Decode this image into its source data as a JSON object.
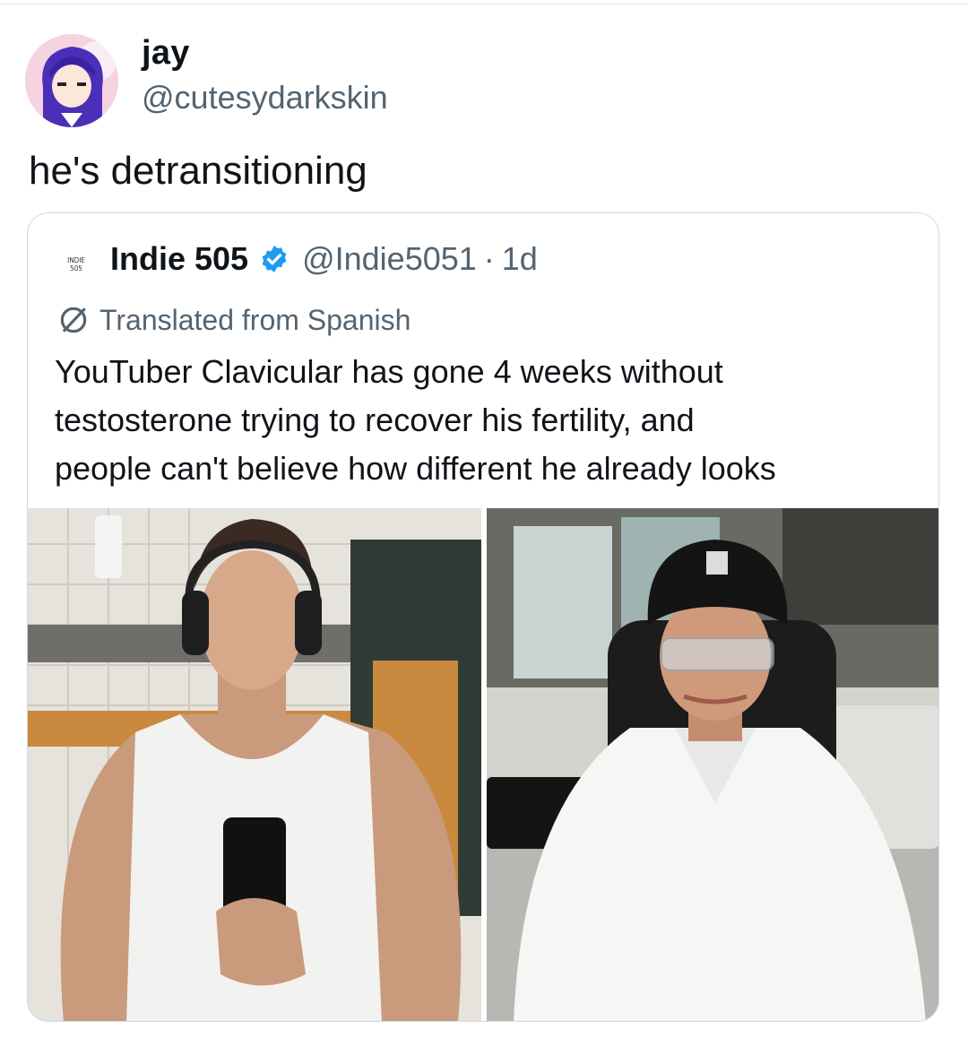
{
  "tweet": {
    "author_name": "jay",
    "author_handle": "@cutesydarkskin",
    "text": "he's detransitioning",
    "avatar_icon": "anime-avatar"
  },
  "quote": {
    "avatar_text_line1": "INDIE",
    "avatar_text_line2": "505",
    "author_name": "Indie 505",
    "verified_icon": "verified-badge-icon",
    "author_handle": "@Indie5051",
    "separator": "·",
    "time": "1d",
    "translated_label": "Translated from Spanish",
    "text_lines": [
      "YouTuber Clavicular has gone 4 weeks without",
      "testosterone trying to recover his fertility, and",
      "people can't believe how different he already looks"
    ],
    "media": [
      {
        "name": "mirror-selfie-photo"
      },
      {
        "name": "streamer-photo"
      }
    ]
  },
  "colors": {
    "text": "#0f1419",
    "secondary": "#536471",
    "verified": "#1d9bf0",
    "border": "#cfd9de"
  }
}
